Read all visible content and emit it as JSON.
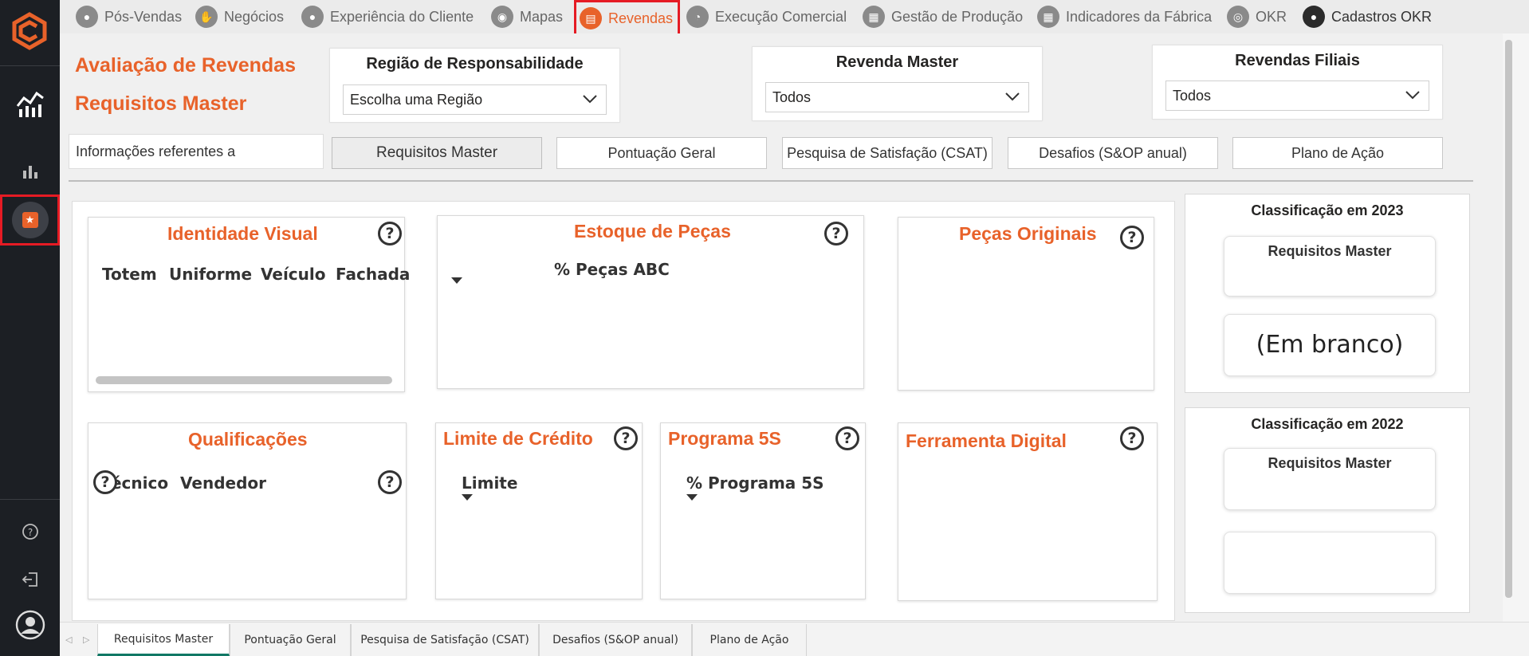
{
  "nav": {
    "items": [
      {
        "label": "Pós-Vendas",
        "icon": "person-icon"
      },
      {
        "label": "Negócios",
        "icon": "handshake-icon"
      },
      {
        "label": "Experiência do Cliente",
        "icon": "person-icon"
      },
      {
        "label": "Mapas",
        "icon": "map-person-icon"
      },
      {
        "label": "Revendas",
        "icon": "store-icon"
      },
      {
        "label": "Execução Comercial",
        "icon": "pie-icon"
      },
      {
        "label": "Gestão de Produção",
        "icon": "factory-icon"
      },
      {
        "label": "Indicadores da Fábrica",
        "icon": "factory-icon"
      },
      {
        "label": "OKR",
        "icon": "target-icon"
      },
      {
        "label": "Cadastros OKR",
        "icon": "user-icon"
      }
    ],
    "active": "Revendas"
  },
  "page": {
    "title_line1": "Avaliação de Revendas",
    "title_line2": "Requisitos Master",
    "info_text": "Informações referentes a"
  },
  "slicers": {
    "region": {
      "label": "Região de Responsabilidade",
      "value": "Escolha uma Região"
    },
    "master": {
      "label": "Revenda Master",
      "value": "Todos"
    },
    "filiais": {
      "label": "Revendas Filiais",
      "value": "Todos"
    }
  },
  "tabs": [
    "Requisitos Master",
    "Pontuação Geral",
    "Pesquisa de Satisfação (CSAT)",
    "Desafios (S&OP anual)",
    "Plano de Ação"
  ],
  "cards": {
    "identidade": {
      "title": "Identidade Visual",
      "columns": [
        "Totem",
        "Uniforme",
        "Veículo",
        "Fachada"
      ]
    },
    "estoque": {
      "title": "Estoque de Peças",
      "column": "% Peças ABC"
    },
    "originais": {
      "title": "Peças Originais"
    },
    "qualificacoes": {
      "title": "Qualificações",
      "columns": [
        "Técnico",
        "Vendedor"
      ]
    },
    "credito": {
      "title": "Limite de Crédito",
      "column": "Limite"
    },
    "programa5s": {
      "title": "Programa 5S",
      "column": "% Programa 5S"
    },
    "ferramenta": {
      "title": "Ferramenta Digital"
    }
  },
  "classificacao": {
    "y2023": {
      "title": "Classificação em 2023",
      "kpi_label": "Requisitos Master",
      "value": "(Em branco)"
    },
    "y2022": {
      "title": "Classificação em 2022",
      "kpi_label": "Requisitos Master",
      "value": ""
    }
  },
  "help_symbol": "?",
  "bottom_tabs": [
    "Requisitos Master",
    "Pontuação Geral",
    "Pesquisa de Satisfação (CSAT)",
    "Desafios (S&OP anual)",
    "Plano de Ação"
  ],
  "colors": {
    "accent": "#e8622a",
    "highlight": "#e51b24",
    "sidebar": "#1c1f24",
    "active_tab_underline": "#117865"
  }
}
